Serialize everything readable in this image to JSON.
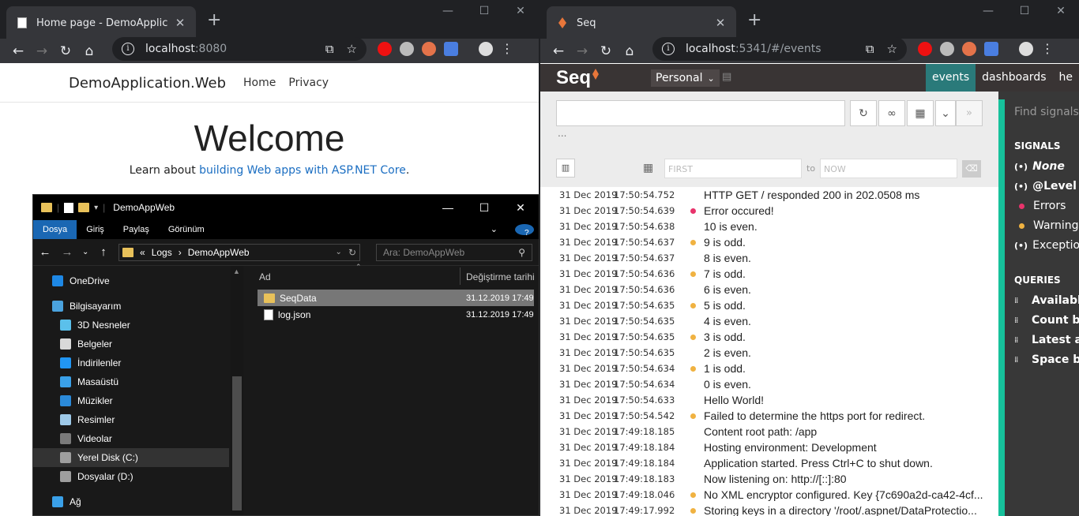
{
  "left_browser": {
    "tab_title": "Home page - DemoApplication.W",
    "omnibox": {
      "host": "localhost",
      "rest": ":8080"
    },
    "page": {
      "brand": "DemoApplication.Web",
      "nav": [
        "Home",
        "Privacy"
      ],
      "heading": "Welcome",
      "learn_prefix": "Learn about ",
      "learn_link": "building Web apps with ASP.NET Core",
      "learn_suffix": "."
    }
  },
  "explorer": {
    "title": "DemoAppWeb",
    "ribbon": [
      "Dosya",
      "Giriş",
      "Paylaş",
      "Görünüm"
    ],
    "breadcrumb": {
      "sep": "«",
      "path1": "Logs",
      "path2": "DemoAppWeb"
    },
    "search_placeholder": "Ara: DemoAppWeb",
    "nav_items": [
      {
        "label": "OneDrive",
        "icon": "cloud-icon",
        "color": "#1e88e5"
      },
      {
        "label": "Bilgisayarım",
        "icon": "computer-icon",
        "color": "#4aa3df"
      },
      {
        "label": "3D Nesneler",
        "icon": "cube-icon",
        "color": "#5bc0eb"
      },
      {
        "label": "Belgeler",
        "icon": "document-icon",
        "color": "#d9d9d9"
      },
      {
        "label": "İndirilenler",
        "icon": "download-icon",
        "color": "#2196f3"
      },
      {
        "label": "Masaüstü",
        "icon": "desktop-icon",
        "color": "#3aa0e8"
      },
      {
        "label": "Müzikler",
        "icon": "music-icon",
        "color": "#2b8ad9"
      },
      {
        "label": "Resimler",
        "icon": "pictures-icon",
        "color": "#9ec9e8"
      },
      {
        "label": "Videolar",
        "icon": "video-icon",
        "color": "#7a7a7a"
      },
      {
        "label": "Yerel Disk (C:)",
        "icon": "drive-icon",
        "color": "#9e9e9e"
      },
      {
        "label": "Dosyalar (D:)",
        "icon": "drive-icon",
        "color": "#9e9e9e"
      },
      {
        "label": "Ağ",
        "icon": "network-icon",
        "color": "#3aa0e8"
      }
    ],
    "columns": {
      "name": "Ad",
      "date": "Değiştirme tarihi"
    },
    "files": [
      {
        "name": "SeqData",
        "date": "31.12.2019 17:49",
        "icon": "folder-icon"
      },
      {
        "name": "log.json",
        "date": "31.12.2019 17:49",
        "icon": "file-icon"
      }
    ]
  },
  "right_browser": {
    "tab_title": "Seq",
    "omnibox": {
      "host": "localhost",
      "rest": ":5341/#/events"
    },
    "seq": {
      "logo": "Seq",
      "workspace": "Personal",
      "tabs": [
        "events",
        "dashboards",
        "he"
      ],
      "range_from": "FIRST",
      "range_to_label": "to",
      "range_to": "NOW",
      "dots": "...",
      "colors": {
        "error": "#e8336b",
        "warning": "#f0b241"
      },
      "events": [
        {
          "date": "31 Dec 2019",
          "time": "17:50:54.752",
          "level": "",
          "message": "HTTP GET / responded 200 in 202.0508 ms"
        },
        {
          "date": "31 Dec 2019",
          "time": "17:50:54.639",
          "level": "error",
          "message": "Error occured!"
        },
        {
          "date": "31 Dec 2019",
          "time": "17:50:54.638",
          "level": "",
          "message": "10 is even."
        },
        {
          "date": "31 Dec 2019",
          "time": "17:50:54.637",
          "level": "warning",
          "message": "9 is odd."
        },
        {
          "date": "31 Dec 2019",
          "time": "17:50:54.637",
          "level": "",
          "message": "8 is even."
        },
        {
          "date": "31 Dec 2019",
          "time": "17:50:54.636",
          "level": "warning",
          "message": "7 is odd."
        },
        {
          "date": "31 Dec 2019",
          "time": "17:50:54.636",
          "level": "",
          "message": "6 is even."
        },
        {
          "date": "31 Dec 2019",
          "time": "17:50:54.635",
          "level": "warning",
          "message": "5 is odd."
        },
        {
          "date": "31 Dec 2019",
          "time": "17:50:54.635",
          "level": "",
          "message": "4 is even."
        },
        {
          "date": "31 Dec 2019",
          "time": "17:50:54.635",
          "level": "warning",
          "message": "3 is odd."
        },
        {
          "date": "31 Dec 2019",
          "time": "17:50:54.635",
          "level": "",
          "message": "2 is even."
        },
        {
          "date": "31 Dec 2019",
          "time": "17:50:54.634",
          "level": "warning",
          "message": "1 is odd."
        },
        {
          "date": "31 Dec 2019",
          "time": "17:50:54.634",
          "level": "",
          "message": "0 is even."
        },
        {
          "date": "31 Dec 2019",
          "time": "17:50:54.633",
          "level": "",
          "message": "Hello World!"
        },
        {
          "date": "31 Dec 2019",
          "time": "17:50:54.542",
          "level": "warning",
          "message": "Failed to determine the https port for redirect."
        },
        {
          "date": "31 Dec 2019",
          "time": "17:49:18.185",
          "level": "",
          "message": "Content root path: /app"
        },
        {
          "date": "31 Dec 2019",
          "time": "17:49:18.184",
          "level": "",
          "message": "Hosting environment: Development"
        },
        {
          "date": "31 Dec 2019",
          "time": "17:49:18.184",
          "level": "",
          "message": "Application started. Press Ctrl+C to shut down."
        },
        {
          "date": "31 Dec 2019",
          "time": "17:49:18.183",
          "level": "",
          "message": "Now listening on: http://[::]:80"
        },
        {
          "date": "31 Dec 2019",
          "time": "17:49:18.046",
          "level": "warning",
          "message": "No XML encryptor configured. Key {7c690a2d-ca42-4cf..."
        },
        {
          "date": "31 Dec 2019",
          "time": "17:49:17.992",
          "level": "warning",
          "message": "Storing keys in a directory '/root/.aspnet/DataProtectio..."
        }
      ],
      "side": {
        "search_placeholder": "Find signals a",
        "signals_heading": "SIGNALS",
        "signals": [
          {
            "label": "None",
            "italic": true,
            "icon": "signal-icon"
          },
          {
            "label": "@Level",
            "italic": false,
            "icon": "signal-icon"
          },
          {
            "label": "Errors",
            "italic": false,
            "icon": "error-dot"
          },
          {
            "label": "Warnings",
            "italic": false,
            "icon": "warning-dot"
          },
          {
            "label": "Exception",
            "italic": false,
            "icon": "signal-icon"
          }
        ],
        "queries_heading": "QUERIES",
        "queries": [
          "Available",
          "Count by",
          "Latest as",
          "Space by"
        ]
      }
    }
  }
}
